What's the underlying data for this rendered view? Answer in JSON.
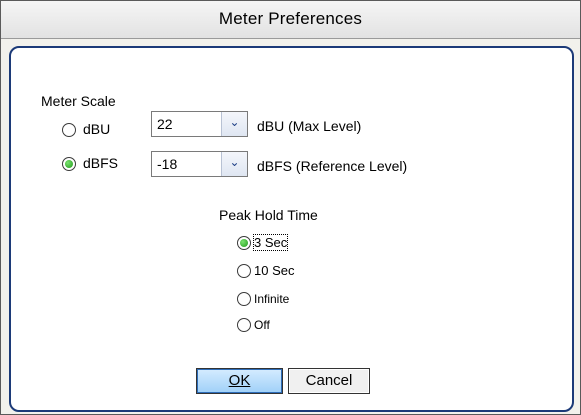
{
  "dialog": {
    "title": "Meter Preferences"
  },
  "meter_scale": {
    "heading": "Meter Scale",
    "dbu": {
      "label": "dBU",
      "selected": false,
      "value": "22",
      "suffix": "dBU (Max Level)"
    },
    "dbfs": {
      "label": "dBFS",
      "selected": true,
      "value": "-18",
      "suffix": "dBFS (Reference Level)"
    }
  },
  "peak_hold": {
    "heading": "Peak Hold Time",
    "options": [
      {
        "label": "3 Sec",
        "selected": true
      },
      {
        "label": "10 Sec",
        "selected": false
      },
      {
        "label": "Infinite",
        "selected": false
      },
      {
        "label": "Off",
        "selected": false
      }
    ]
  },
  "buttons": {
    "ok_label": "OK",
    "cancel_label": "Cancel"
  },
  "colors": {
    "panel_border": "#1c3a78",
    "radio_checked": "#1f9a1a",
    "ok_button": "#9fd0f8"
  },
  "icons": {
    "dropdown": "chevron-down-icon"
  }
}
